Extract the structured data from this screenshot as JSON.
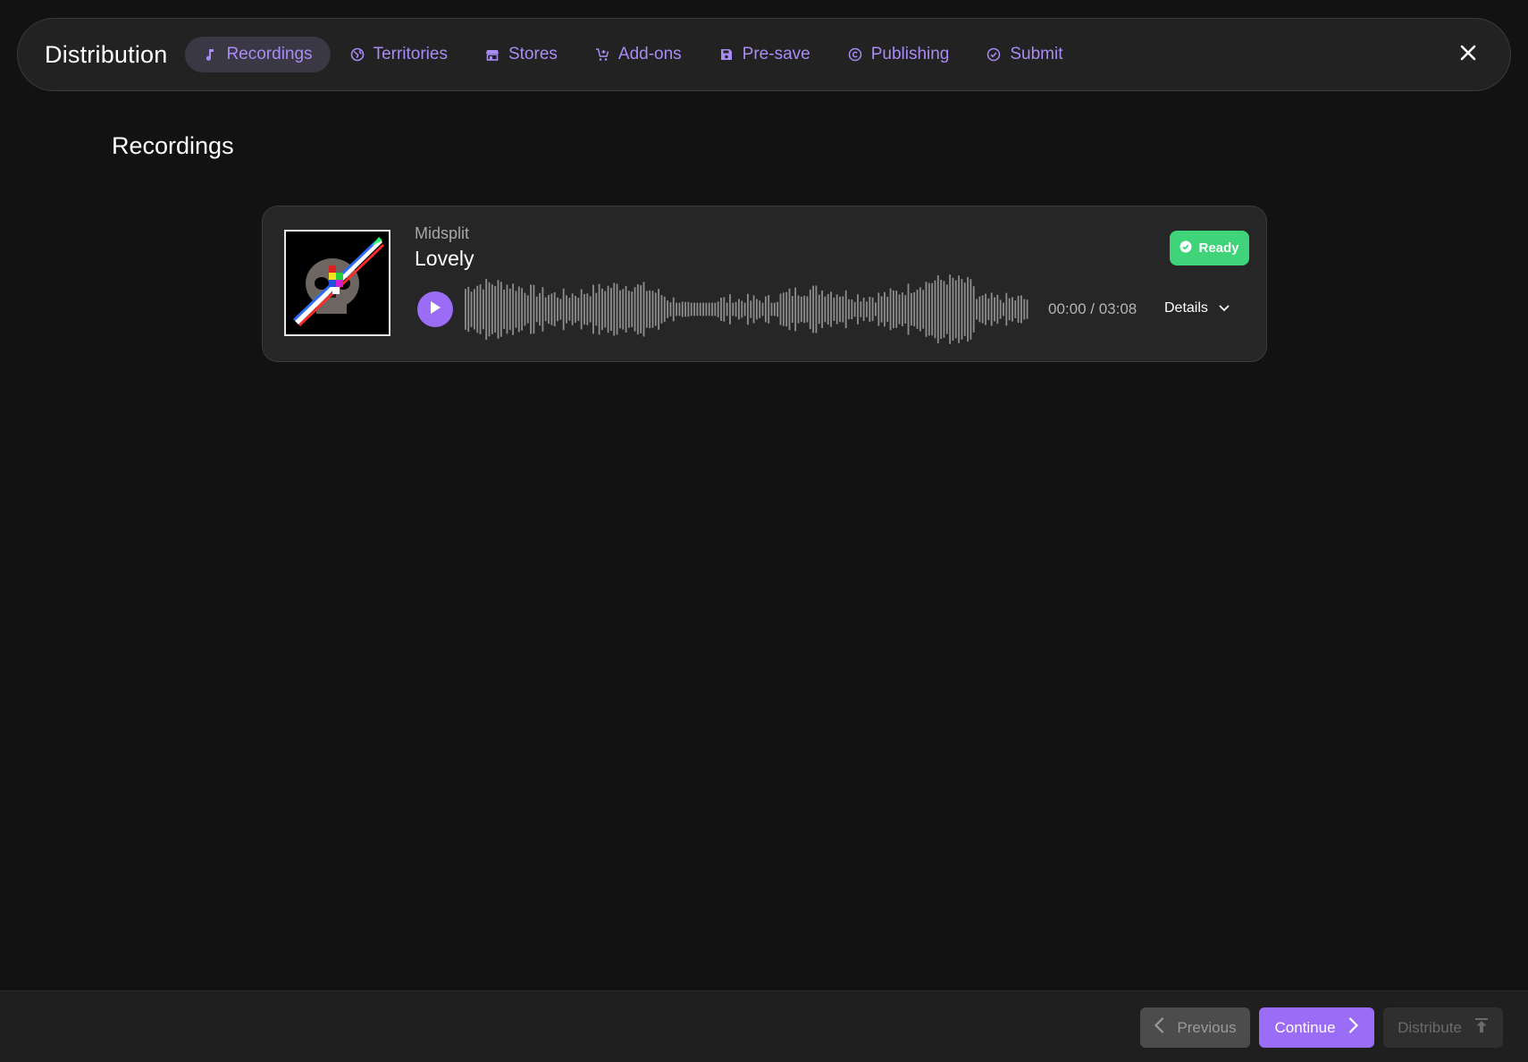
{
  "header": {
    "title": "Distribution",
    "tabs": [
      {
        "label": "Recordings",
        "icon": "music-note-icon",
        "active": true
      },
      {
        "label": "Territories",
        "icon": "globe-icon",
        "active": false
      },
      {
        "label": "Stores",
        "icon": "store-icon",
        "active": false
      },
      {
        "label": "Add-ons",
        "icon": "cart-plus-icon",
        "active": false
      },
      {
        "label": "Pre-save",
        "icon": "save-icon",
        "active": false
      },
      {
        "label": "Publishing",
        "icon": "copyright-icon",
        "active": false
      },
      {
        "label": "Submit",
        "icon": "check-circle-icon",
        "active": false
      }
    ],
    "close_icon": "close-icon"
  },
  "main": {
    "section_title": "Recordings",
    "recording": {
      "artist": "Midsplit",
      "title": "Lovely",
      "time": "00:00 / 03:08",
      "status": "Ready",
      "details_label": "Details",
      "playback_progress": 0
    }
  },
  "footer": {
    "previous_label": "Previous",
    "continue_label": "Continue",
    "distribute_label": "Distribute"
  },
  "colors": {
    "accent": "#9b6cf6",
    "tab_text": "#a98bf5",
    "ready_green": "#3fd479",
    "background": "#121212",
    "panel": "#222222"
  }
}
